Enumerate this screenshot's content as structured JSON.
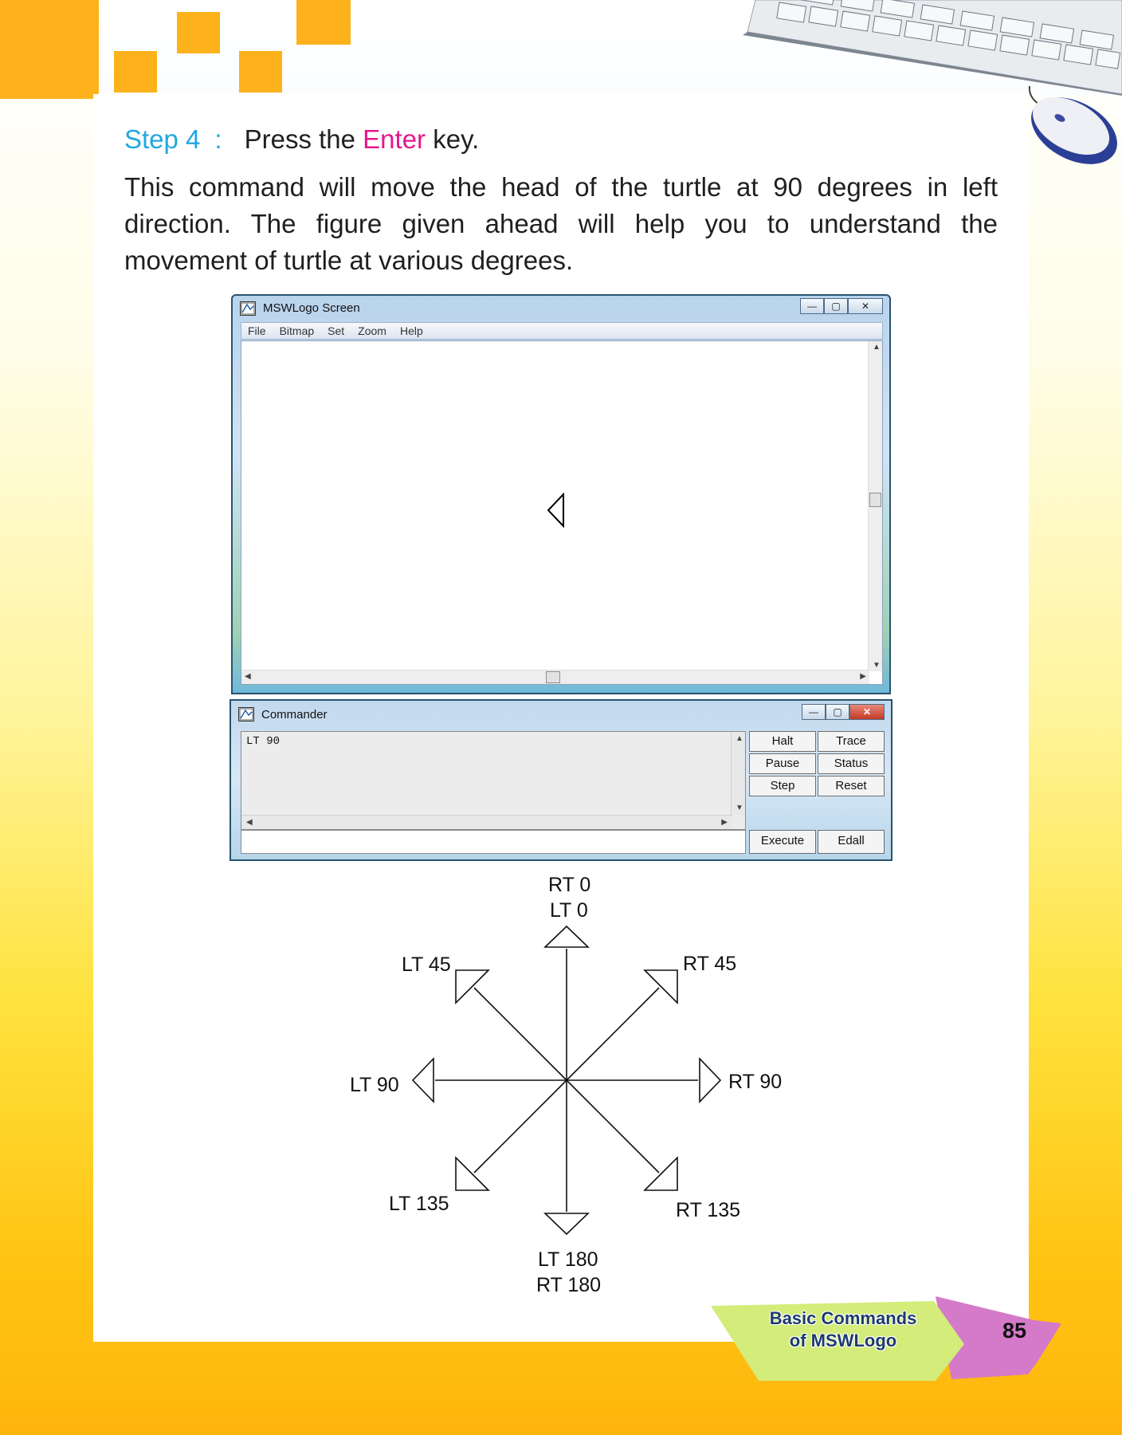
{
  "step": {
    "label": "Step 4",
    "colon": ":",
    "text_before": "Press the",
    "key": "Enter",
    "text_after": "key."
  },
  "description": "This command will move the head of the turtle at 90 degrees in left direction. The figure given ahead will help you to understand the movement of turtle at various degrees.",
  "logo_screen": {
    "title": "MSWLogo Screen",
    "menu": [
      "File",
      "Bitmap",
      "Set",
      "Zoom",
      "Help"
    ],
    "window_buttons": [
      "—",
      "▢",
      "✕"
    ]
  },
  "commander": {
    "title": "Commander",
    "history": "LT 90",
    "input_value": "",
    "buttons": [
      "Halt",
      "Trace",
      "Pause",
      "Status",
      "Step",
      "Reset"
    ],
    "bottom_buttons": [
      "Execute",
      "Edall"
    ]
  },
  "diagram": {
    "top_line1": "RT 0",
    "top_line2": "LT 0",
    "lt45": "LT 45",
    "rt45": "RT 45",
    "lt90": "LT 90",
    "rt90": "RT 90",
    "lt135": "LT 135",
    "rt135": "RT 135",
    "bottom_line1": "LT 180",
    "bottom_line2": "RT 180"
  },
  "footer": {
    "chapter_line1": "Basic Commands",
    "chapter_line2": "of MSWLogo",
    "page_number": "85"
  },
  "colors": {
    "orange": "#fdb21b",
    "step_blue": "#22a7e1",
    "enter_pink": "#e5188a",
    "tag_green": "#d3ec7a",
    "tag_pink": "#d47ac9"
  }
}
